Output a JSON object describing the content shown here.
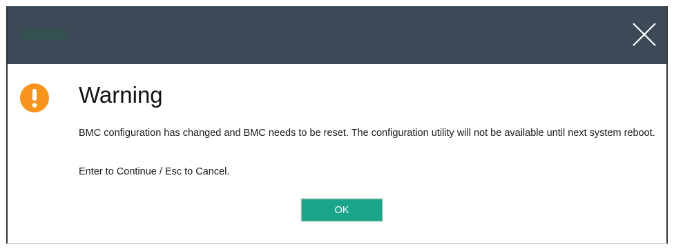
{
  "dialog": {
    "title_icon": "close-icon",
    "warning_icon": "exclamation-icon",
    "heading": "Warning",
    "message": "BMC configuration has changed and BMC needs to be reset. The configuration utility will not be available until next system reboot.",
    "instruction": "Enter to Continue / Esc to Cancel.",
    "ok_label": "OK"
  },
  "colors": {
    "titlebar": "#3c4a57",
    "warning_icon": "#f7941d",
    "ok_button": "#1ba58a"
  }
}
